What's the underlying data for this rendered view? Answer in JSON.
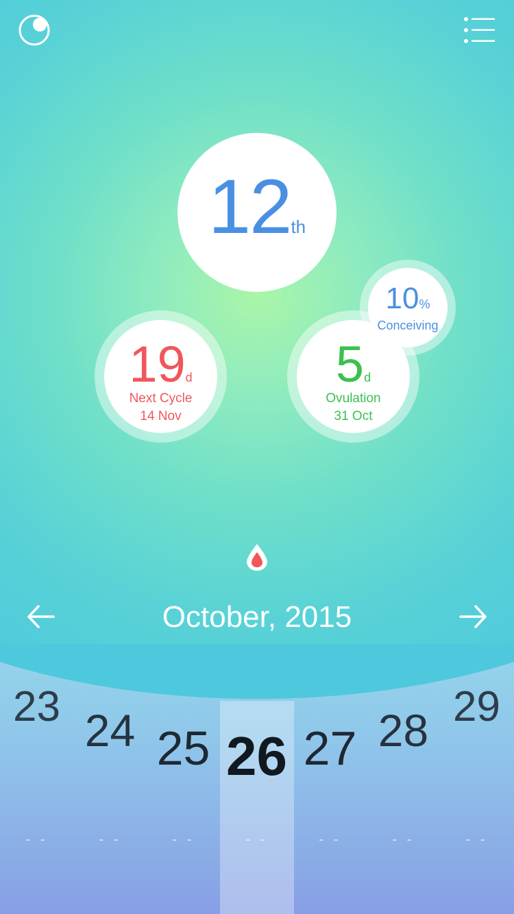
{
  "header": {
    "left_icon": "moon-logo-icon",
    "right_icon": "menu-list-icon"
  },
  "cycle_day": {
    "number": "12",
    "suffix": "th"
  },
  "next_cycle": {
    "value": "19",
    "unit": "d",
    "label": "Next Cycle",
    "date": "14 Nov",
    "color": "#f0575b"
  },
  "ovulation": {
    "value": "5",
    "unit": "d",
    "label": "Ovulation",
    "date": "31 Oct",
    "color": "#3cc04e"
  },
  "conceiving": {
    "value": "10",
    "unit": "%",
    "label": "Conceiving",
    "color": "#4a90e2"
  },
  "drop_icon": "blood-drop-icon",
  "month": {
    "title": "October, 2015",
    "prev_icon": "arrow-left-icon",
    "next_icon": "arrow-right-icon"
  },
  "calendar": {
    "days": [
      {
        "day": "23",
        "dash": "- -"
      },
      {
        "day": "24",
        "dash": "- -"
      },
      {
        "day": "25",
        "dash": "- -"
      },
      {
        "day": "26",
        "dash": "- -",
        "selected": true
      },
      {
        "day": "27",
        "dash": "- -"
      },
      {
        "day": "28",
        "dash": "- -"
      },
      {
        "day": "29",
        "dash": "- -"
      }
    ]
  }
}
